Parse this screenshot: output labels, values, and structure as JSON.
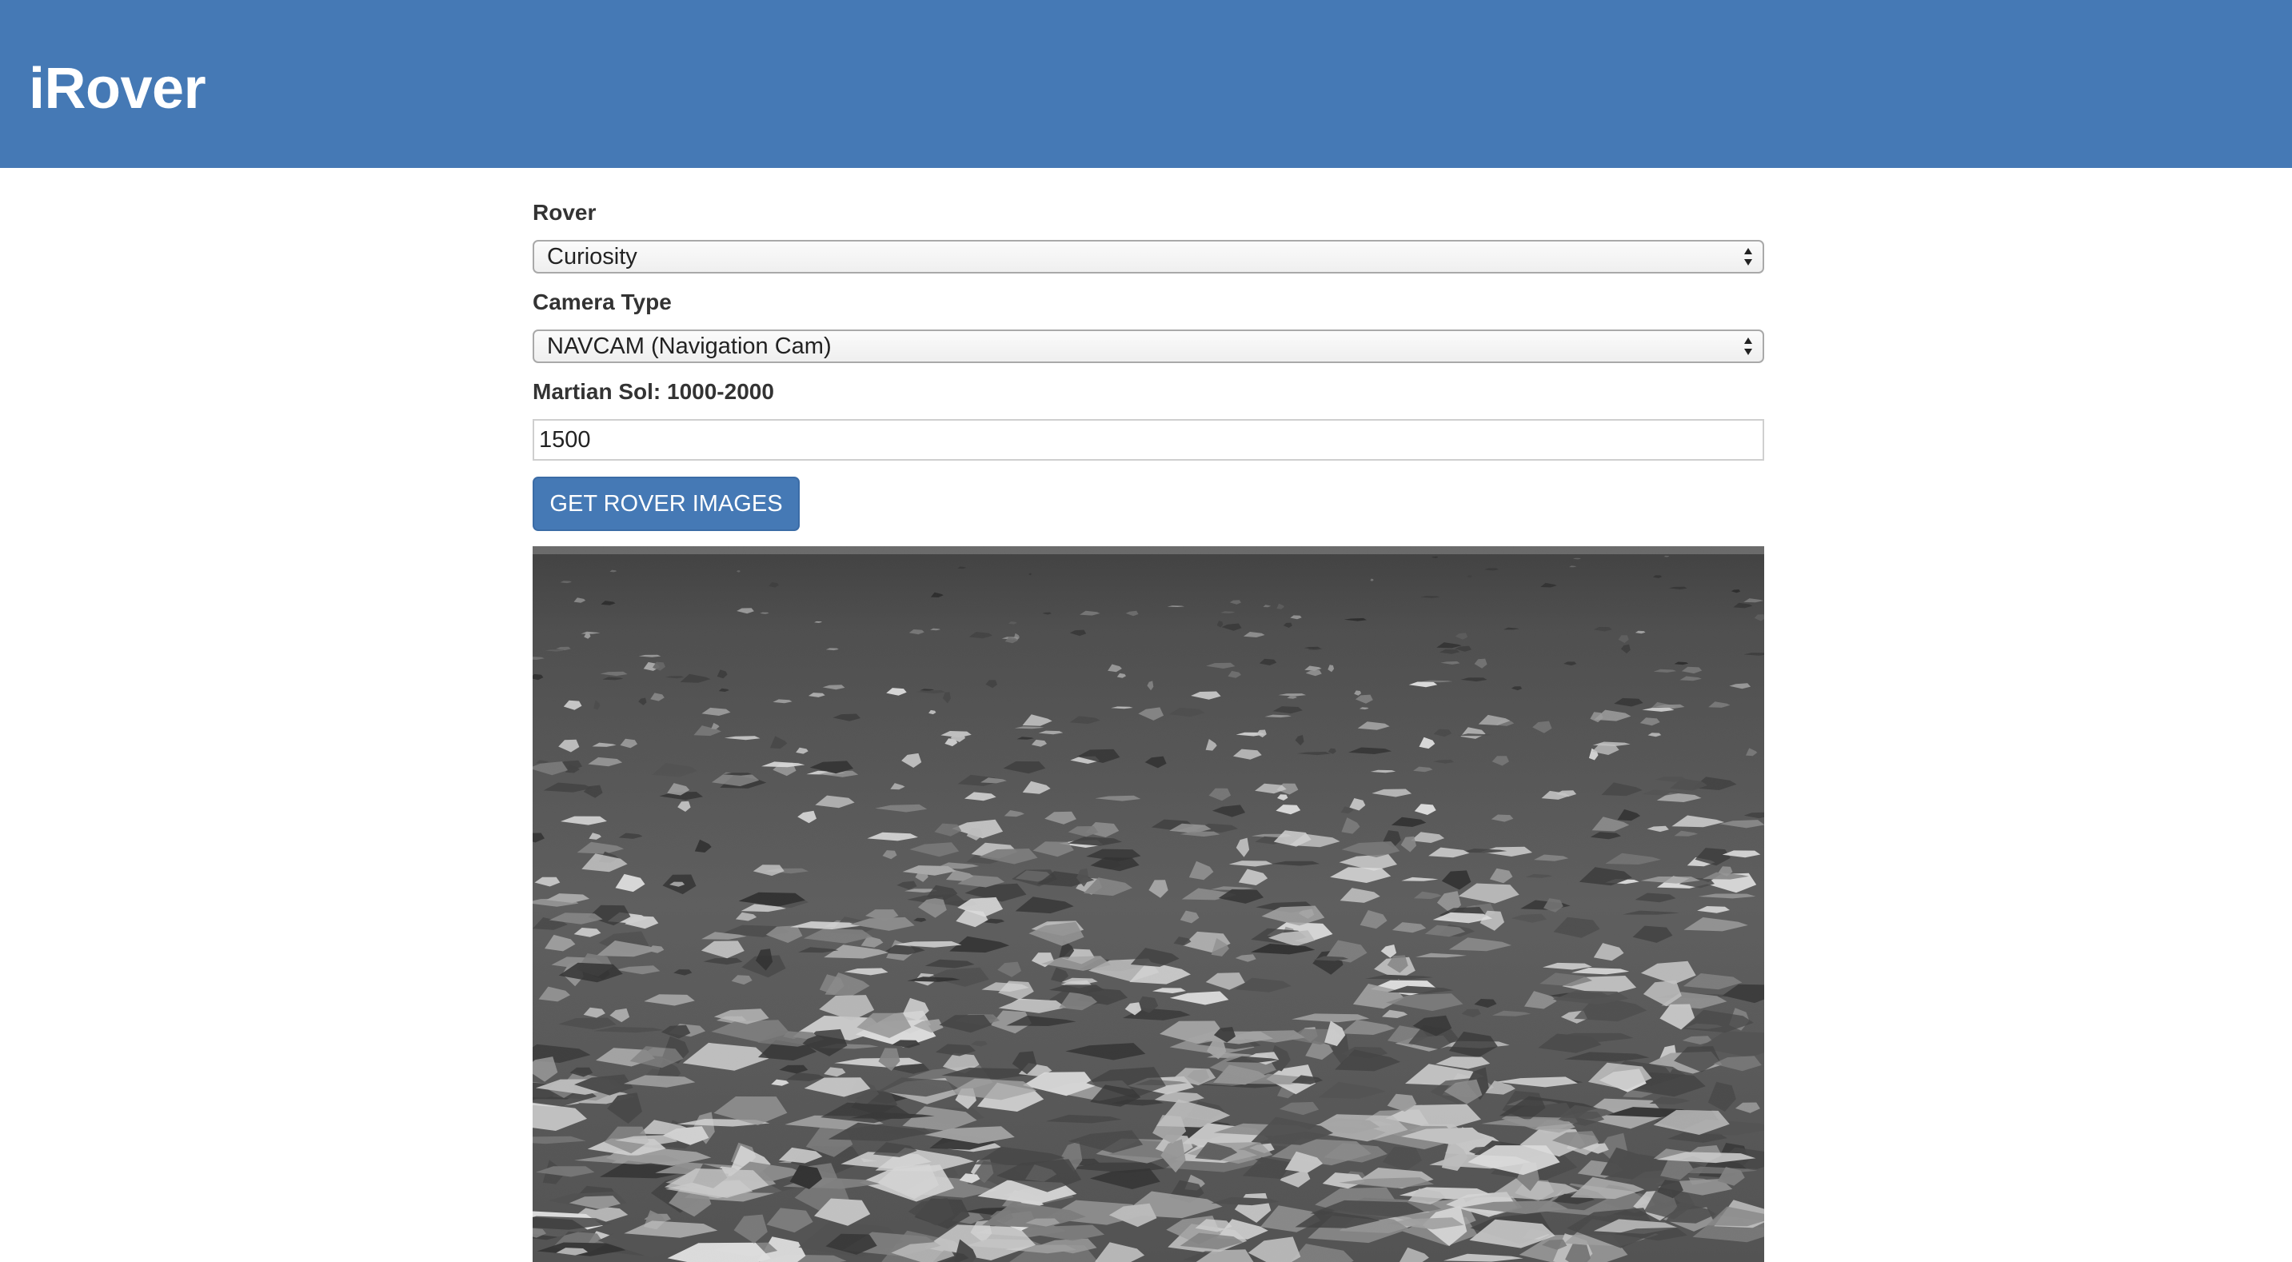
{
  "header": {
    "brand": "iRover",
    "background_color": "#4579b5"
  },
  "form": {
    "rover": {
      "label": "Rover",
      "selected": "Curiosity"
    },
    "camera": {
      "label": "Camera Type",
      "selected": "NAVCAM (Navigation Cam)"
    },
    "sol": {
      "label": "Martian Sol: 1000-2000",
      "value": "1500"
    },
    "submit_label": "GET ROVER IMAGES"
  },
  "result": {
    "image_kind": "grayscale Mars terrain photo",
    "icon": "rover-photo"
  }
}
